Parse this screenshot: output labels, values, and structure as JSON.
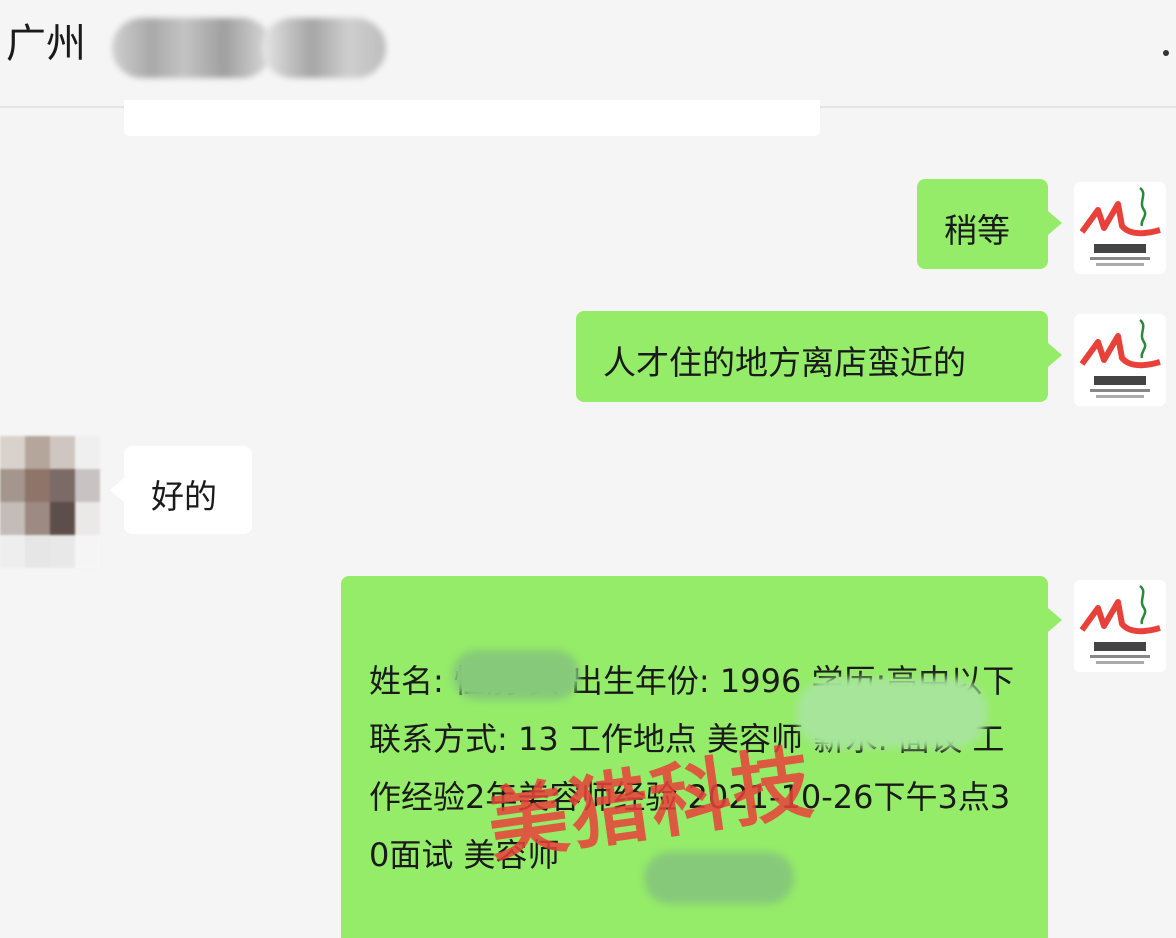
{
  "header": {
    "title": "广州"
  },
  "messages": [
    {
      "side": "right",
      "text": "稍等"
    },
    {
      "side": "right",
      "text": "人才住的地方离店蛮近的"
    },
    {
      "side": "left",
      "text": "好的"
    },
    {
      "side": "right",
      "text": "姓名: 性别:女 出生年份: 1996 学历:高中以下 联系方式: 13 工作地点 美容师 薪水: 面议 工作经验2年美容师经验 2021-10-26下午3点30面试 美容师"
    }
  ],
  "avatar_logo": {
    "brand": "美猎客服2",
    "color": "#e8413a",
    "icon": "ml-logo-icon"
  },
  "watermark": "美猎科技"
}
